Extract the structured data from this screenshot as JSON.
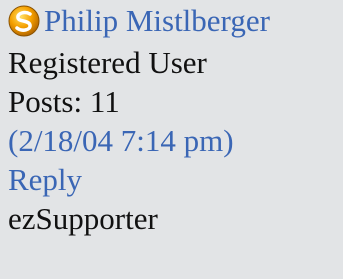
{
  "author": {
    "name": "Philip Mistlberger",
    "role": "Registered User",
    "posts": "Posts: 11"
  },
  "post": {
    "timestamp": "(2/18/04 7:14 pm)",
    "reply_label": "Reply"
  },
  "footer": {
    "group": "ezSupporter"
  },
  "colors": {
    "background": "#e2e4e6",
    "link": "#3a66b5",
    "text": "#111111",
    "logo_orange": "#f5a000"
  },
  "icons": {
    "author_logo": "ezboard-orange-swirl-icon"
  }
}
